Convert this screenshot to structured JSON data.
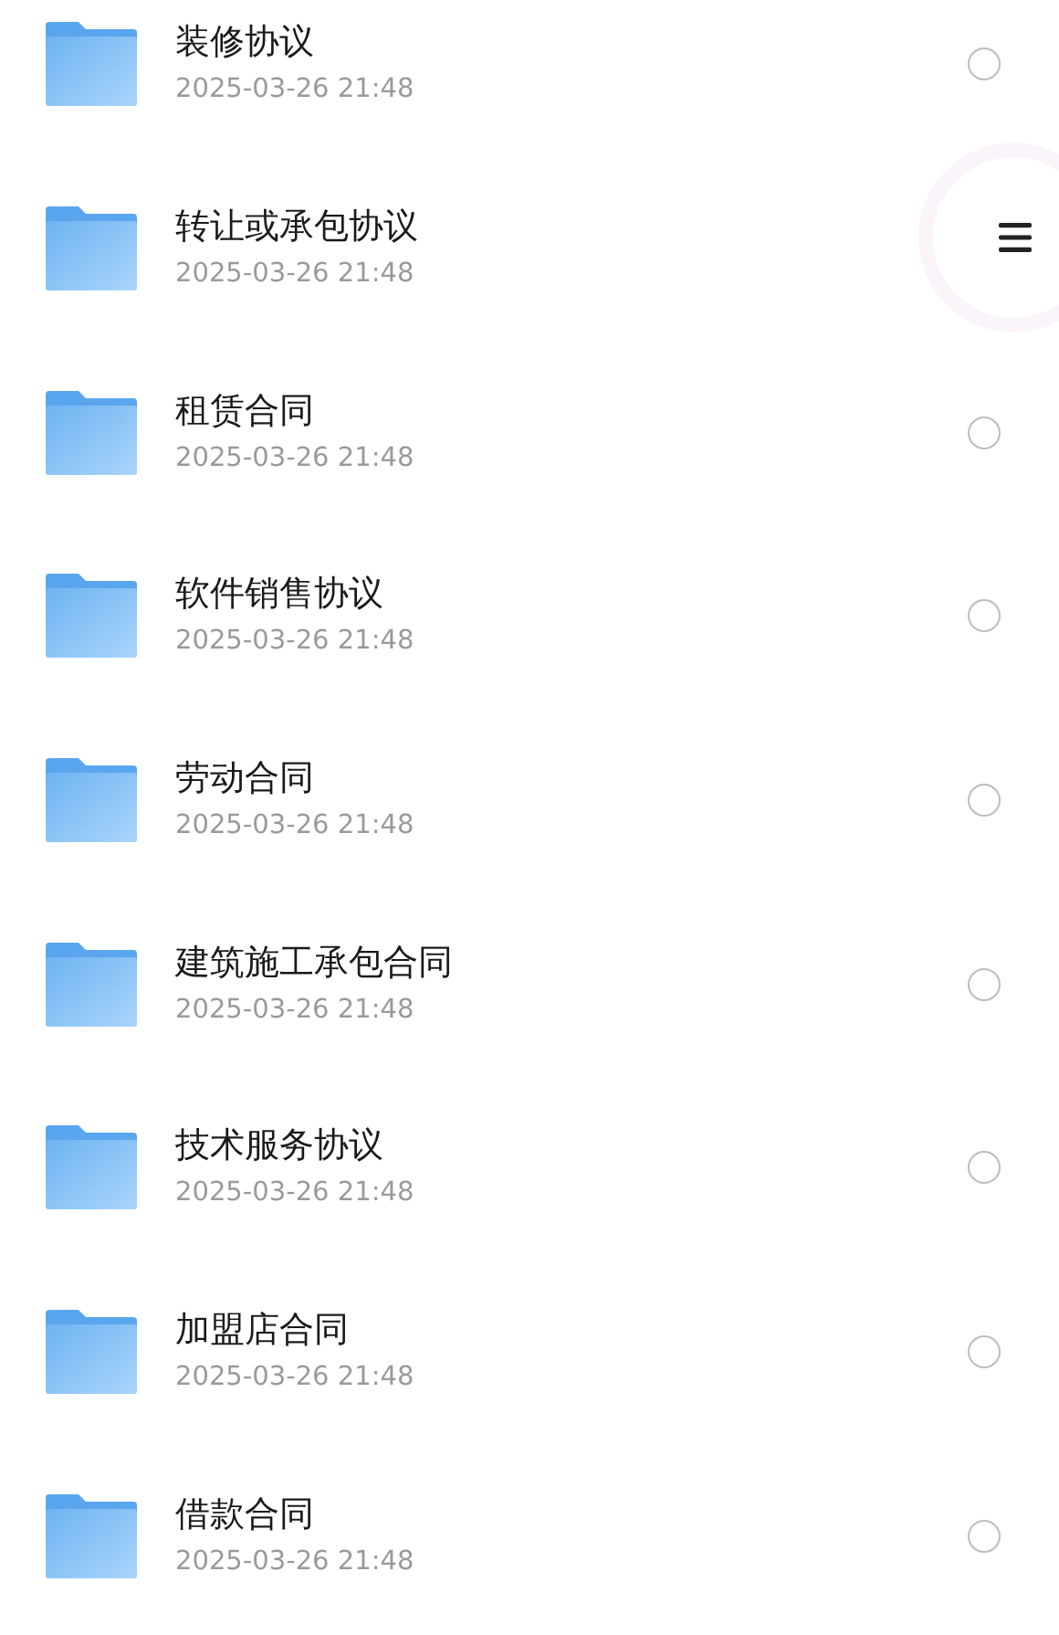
{
  "files": [
    {
      "name": "装修协议",
      "date": "2025-03-26 21:48",
      "selected": false
    },
    {
      "name": "转让或承包协议",
      "date": "2025-03-26 21:48"
    },
    {
      "name": "租赁合同",
      "date": "2025-03-26 21:48",
      "selected": false
    },
    {
      "name": "软件销售协议",
      "date": "2025-03-26 21:48",
      "selected": false
    },
    {
      "name": "劳动合同",
      "date": "2025-03-26 21:48",
      "selected": false
    },
    {
      "name": "建筑施工承包合同",
      "date": "2025-03-26 21:48",
      "selected": false
    },
    {
      "name": "技术服务协议",
      "date": "2025-03-26 21:48",
      "selected": false
    },
    {
      "name": "加盟店合同",
      "date": "2025-03-26 21:48",
      "selected": false
    },
    {
      "name": "借款合同",
      "date": "2025-03-26 21:48",
      "selected": false
    }
  ]
}
